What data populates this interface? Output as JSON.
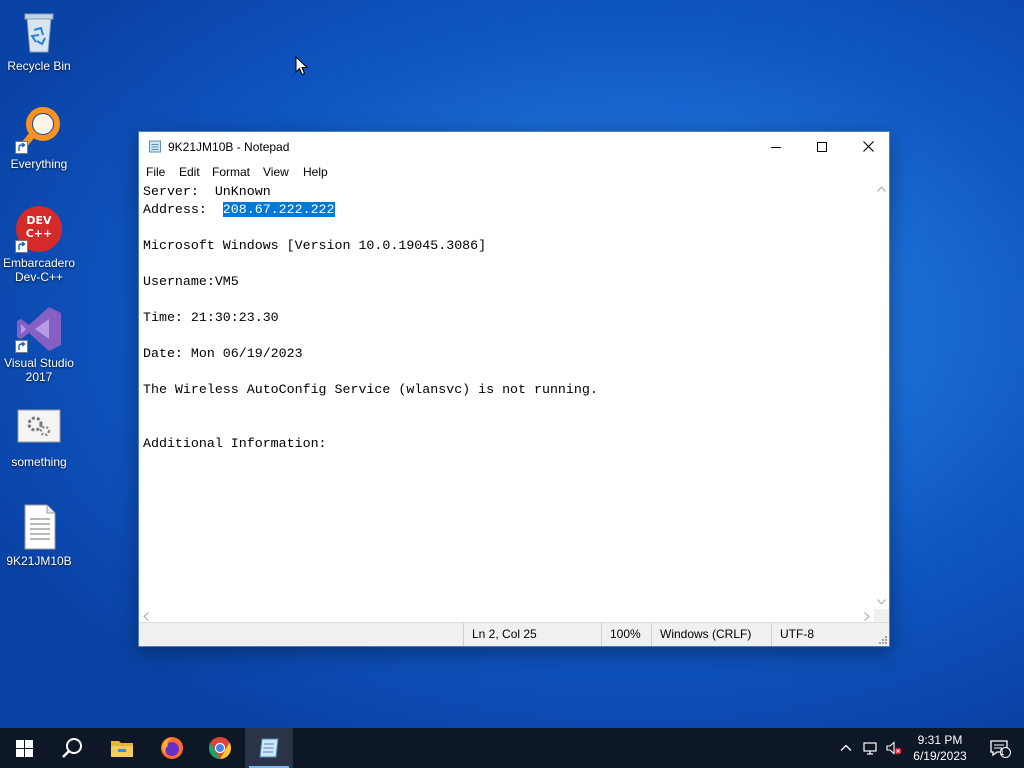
{
  "desktop": {
    "icons": [
      {
        "label": "Recycle Bin"
      },
      {
        "label": "Everything"
      },
      {
        "label": "Embarcadero Dev-C++",
        "badge": "DEV C++"
      },
      {
        "label": "Visual Studio 2017"
      },
      {
        "label": "something"
      },
      {
        "label": "9K21JM10B"
      }
    ]
  },
  "window": {
    "title": "9K21JM10B - Notepad",
    "menu": [
      "File",
      "Edit",
      "Format",
      "View",
      "Help"
    ],
    "content": {
      "line1": "Server:  UnKnown",
      "line2_prefix": "Address:  ",
      "line2_selected": "208.67.222.222",
      "rest": "\n\nMicrosoft Windows [Version 10.0.19045.3086]\n\nUsername:VM5\n\nTime: 21:30:23.30\n\nDate: Mon 06/19/2023\n\nThe Wireless AutoConfig Service (wlansvc) is not running.\n\n\nAdditional Information:"
    },
    "status": {
      "position": "Ln 2, Col 25",
      "zoom": "100%",
      "line_ending": "Windows (CRLF)",
      "encoding": "UTF-8"
    }
  },
  "taskbar": {
    "items": [
      "start-icon",
      "search-icon",
      "file-explorer-icon",
      "firefox-icon",
      "chrome-icon",
      "notepad-icon"
    ],
    "clock": {
      "time": "9:31 PM",
      "date": "6/19/2023"
    },
    "notification_count": "1"
  },
  "colors": {
    "selection": "#0078d7",
    "taskbar": "#0e1726",
    "accent": "#76b9ed"
  }
}
